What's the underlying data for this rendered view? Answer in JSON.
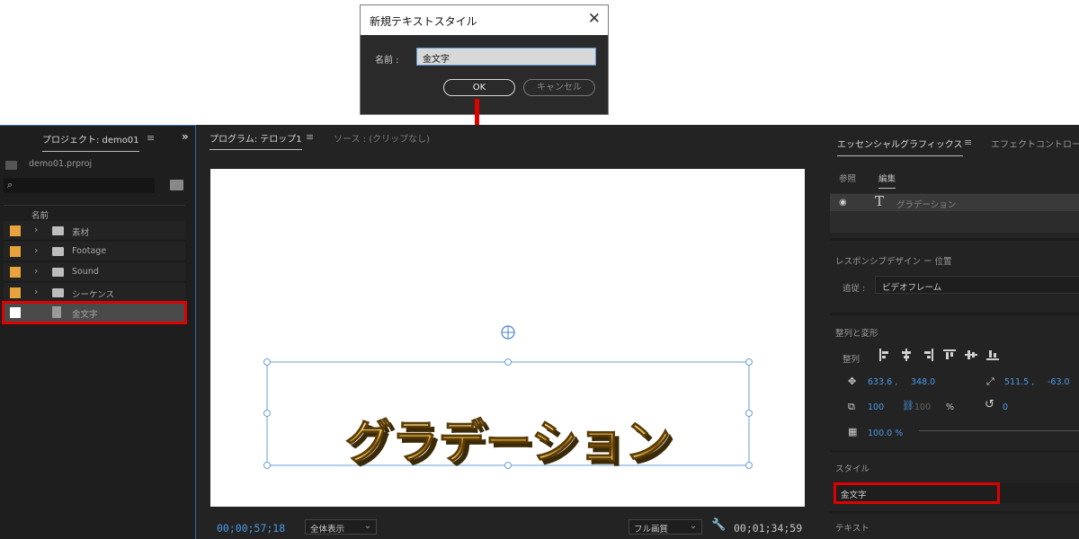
{
  "dialog": {
    "title": "新規テキストスタイル",
    "close_glyph": "✕",
    "name_label": "名前 :",
    "name_value": "金文字",
    "ok_label": "OK",
    "cancel_label": "キャンセル"
  },
  "project": {
    "tab_label": "プロジェクト: demo01",
    "menu_glyph": "≡",
    "expand_glyph": "»",
    "project_file": "demo01.prproj",
    "search_glyph": "⌕",
    "column_name": "名前",
    "items": [
      {
        "label": "素材",
        "type": "folder"
      },
      {
        "label": "Footage",
        "type": "folder"
      },
      {
        "label": "Sound",
        "type": "folder"
      },
      {
        "label": "シーケンス",
        "type": "folder"
      },
      {
        "label": "金文字",
        "type": "file"
      }
    ],
    "chevron_glyph": "›"
  },
  "program": {
    "tab_label": "プログラム: テロップ1",
    "menu_glyph": "≡",
    "source_tab": "ソース : (クリップなし)",
    "title_text": "グラデーション",
    "timecode_current": "00;00;57;18",
    "zoom_value": "全体表示",
    "quality_value": "フル画質",
    "timecode_duration": "00;01;34;59",
    "wrench_glyph": "🔧"
  },
  "essential": {
    "tab_label": "エッセンシャルグラフィックス",
    "menu_glyph": "≡",
    "effect_tab": "エフェクトコントロール",
    "subtab_browse": "参照",
    "subtab_edit": "編集",
    "layer_name": "グラデーション",
    "responsive_header": "レスポンシブデザイン ー 位置",
    "follow_label": "追従 :",
    "follow_value": "ビデオフレーム",
    "align_header": "整列と変形",
    "align_label": "整列",
    "pos_x": "633.6 ,",
    "pos_y": "348.0",
    "anchor_x": "511.5 ,",
    "anchor_y": "-63.0",
    "scale_w": "100",
    "scale_h": "100",
    "percent": "%",
    "rotation": "0",
    "opacity": "100.0 %",
    "style_header": "スタイル",
    "style_value": "金文字",
    "text_header": "テキスト",
    "accent_color": "#4a9ae8",
    "highlight_color": "#e00000"
  }
}
